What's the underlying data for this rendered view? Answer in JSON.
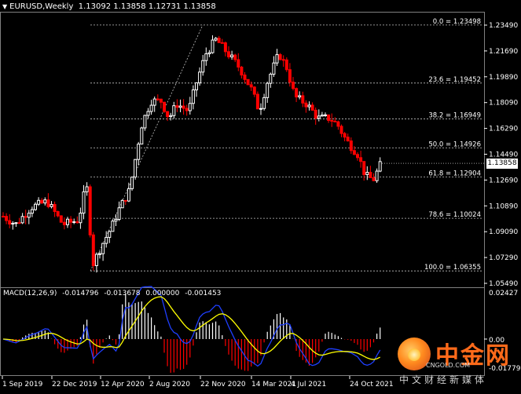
{
  "window": {
    "symbol_timeframe": "EURUSD,Weekly",
    "ohlc": [
      "1.13092",
      "1.13858",
      "1.12731",
      "1.13858"
    ]
  },
  "current_price_label": "1.13858",
  "fib_levels": [
    {
      "label": "0.0 = 1.23498",
      "value": 1.23498
    },
    {
      "label": "23.6 = 1.19452",
      "value": 1.19452
    },
    {
      "label": "38.2 = 1.16949",
      "value": 1.16949
    },
    {
      "label": "50.0 = 1.14926",
      "value": 1.14926
    },
    {
      "label": "61.8 = 1.12904",
      "value": 1.12904
    },
    {
      "label": "78.6 = 1.10024",
      "value": 1.10024
    },
    {
      "label": "100.0 = 1.06355",
      "value": 1.06355
    }
  ],
  "price_axis_ticks": [
    "1.23490",
    "1.21690",
    "1.19890",
    "1.18090",
    "1.16290",
    "1.14490",
    "1.12690",
    "1.10890",
    "1.09090",
    "1.07290",
    "1.05490"
  ],
  "macd": {
    "header": "MACD(12,26,9)",
    "values": [
      "-0.014796",
      "-0.013678",
      "0.000000",
      "-0.001453"
    ],
    "axis_ticks": [
      "0.02427",
      "0.00",
      "-0.017798"
    ]
  },
  "time_axis_ticks": [
    "1 Sep 2019",
    "22 Dec 2019",
    "12 Apr 2020",
    "2 Aug 2020",
    "22 Nov 2020",
    "14 Mar 2021",
    "4 Jul 2021",
    "24 Oct 2021"
  ],
  "colors": {
    "bull": "#ffffff",
    "bear": "#ff0000",
    "signal": "#ffff00",
    "main_line": "#1f3fff",
    "grid": "#c0c0c0"
  },
  "watermark": {
    "brand": "中金网",
    "url": "CNGOLD.COM",
    "tagline": "中文财经新媒体"
  }
}
